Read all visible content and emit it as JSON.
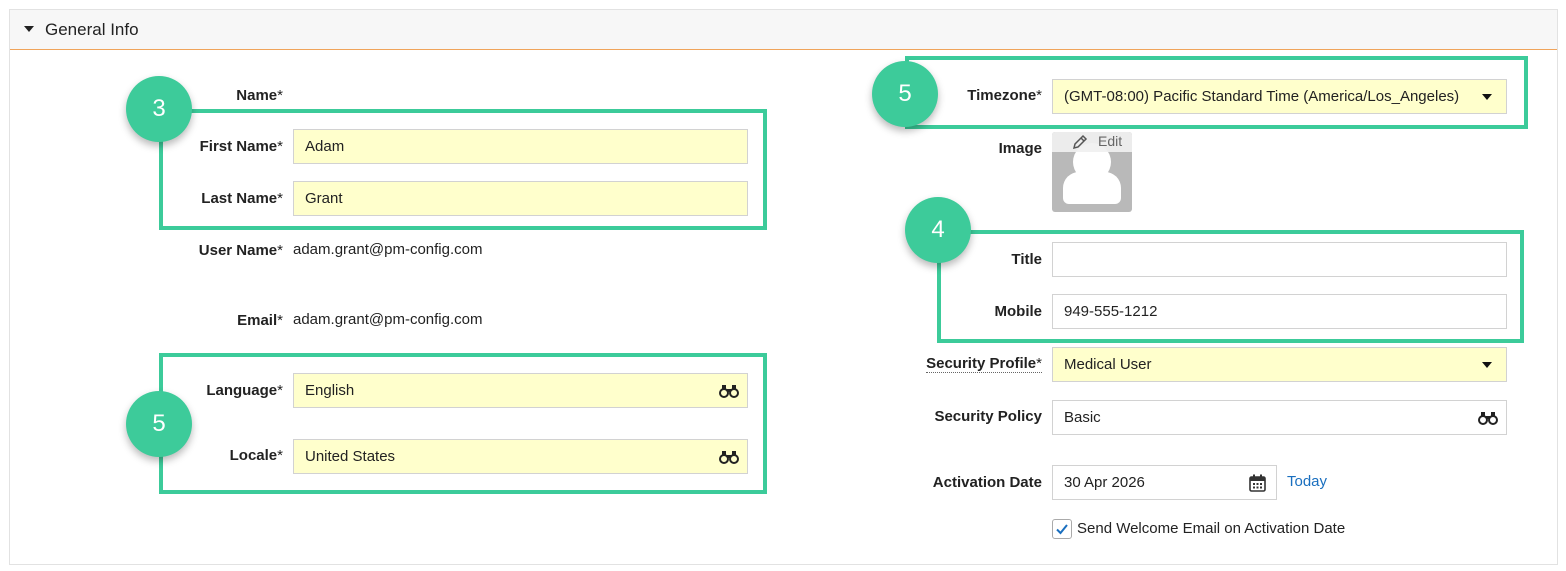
{
  "section": {
    "title": "General Info"
  },
  "labels": {
    "name": "Name",
    "first_name": "First Name",
    "last_name": "Last Name",
    "user_name": "User Name",
    "email": "Email",
    "language": "Language",
    "locale": "Locale",
    "timezone": "Timezone",
    "image": "Image",
    "title": "Title",
    "mobile": "Mobile",
    "security_profile": "Security Profile",
    "security_policy": "Security Policy",
    "activation_date": "Activation Date",
    "required_marker": "*"
  },
  "values": {
    "first_name": "Adam",
    "last_name": "Grant",
    "user_name": "adam.grant@pm-config.com",
    "email": "adam.grant@pm-config.com",
    "language": "English",
    "locale": "United States",
    "timezone": "(GMT-08:00) Pacific Standard Time (America/Los_Angeles)",
    "title": "",
    "mobile": "949-555-1212",
    "security_profile": "Medical User",
    "security_policy": "Basic",
    "activation_date": "30 Apr 2026"
  },
  "image": {
    "edit_label": "Edit"
  },
  "actions": {
    "today_label": "Today"
  },
  "send_welcome": {
    "label": "Send Welcome Email on Activation Date",
    "checked": true
  },
  "callouts": {
    "name_fields": "3",
    "language_locale": "5",
    "timezone": "5",
    "title_mobile": "4"
  },
  "colors": {
    "highlight": "#3ccb9a",
    "required_field_bg": "#ffffcc",
    "header_accent": "#f0a45b",
    "link": "#1a6fbf"
  },
  "icons": [
    "caret-down-icon",
    "binoculars-icon",
    "calendar-icon",
    "pencil-icon",
    "checkmark-icon",
    "user-silhouette-icon"
  ]
}
